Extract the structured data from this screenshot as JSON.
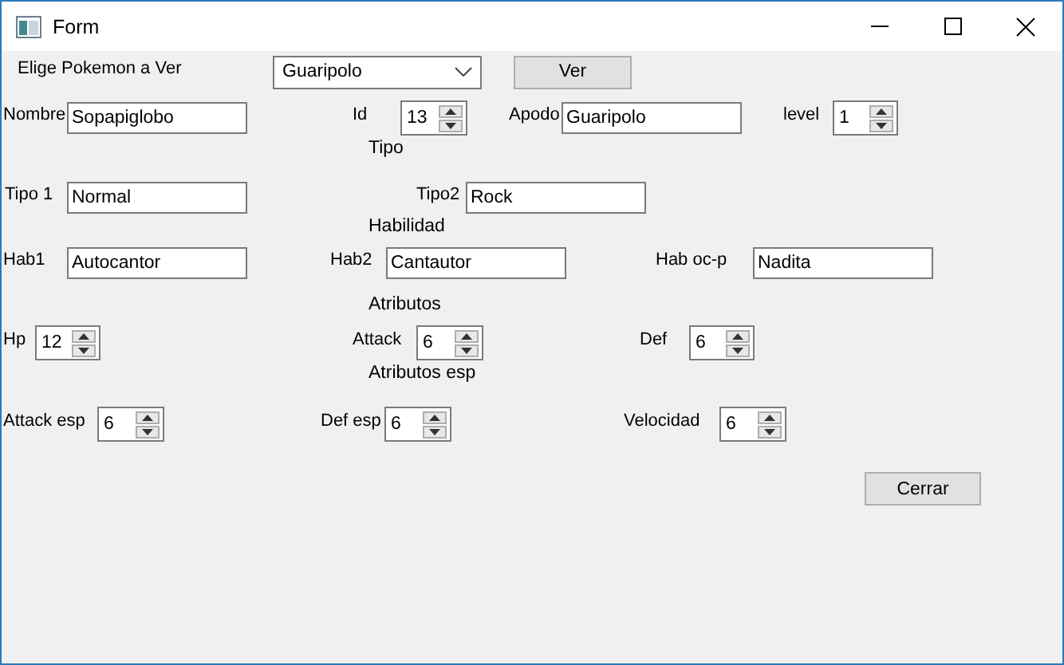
{
  "window": {
    "title": "Form"
  },
  "rows": [
    {
      "items": [
        {
          "kind": "label",
          "text": "Elige Pokemon a Ver"
        },
        {
          "kind": "combo",
          "value": "Guaripolo"
        },
        {
          "kind": "button",
          "text": "Ver"
        }
      ]
    },
    {
      "items": [
        {
          "kind": "label",
          "text": "Nombre"
        },
        {
          "kind": "text",
          "value": "Sopapiglobo"
        },
        {
          "kind": "label",
          "text": "Id"
        },
        {
          "kind": "spin",
          "value": "13"
        },
        {
          "kind": "label",
          "text": "Apodo"
        },
        {
          "kind": "text",
          "value": "Guaripolo"
        },
        {
          "kind": "label",
          "text": "level"
        },
        {
          "kind": "spin",
          "value": "1"
        }
      ]
    },
    {
      "section": "Tipo",
      "items": [
        {
          "kind": "label",
          "text": "Tipo 1"
        },
        {
          "kind": "text",
          "value": "Normal"
        },
        {
          "kind": "label",
          "text": "Tipo2"
        },
        {
          "kind": "text",
          "value": "Rock"
        }
      ]
    },
    {
      "section": "Habilidad",
      "items": [
        {
          "kind": "label",
          "text": "Hab1"
        },
        {
          "kind": "text",
          "value": "Autocantor"
        },
        {
          "kind": "label",
          "text": "Hab2"
        },
        {
          "kind": "text",
          "value": "Cantautor"
        },
        {
          "kind": "label",
          "text": "Hab  oc-p"
        },
        {
          "kind": "text",
          "value": "Nadita"
        }
      ]
    },
    {
      "section": "Atributos",
      "items": [
        {
          "kind": "label",
          "text": "Hp"
        },
        {
          "kind": "spin",
          "value": "12"
        },
        {
          "kind": "label",
          "text": "Attack"
        },
        {
          "kind": "spin",
          "value": "6"
        },
        {
          "kind": "label",
          "text": "Def"
        },
        {
          "kind": "spin",
          "value": "6"
        }
      ]
    },
    {
      "section": "Atributos esp",
      "items": [
        {
          "kind": "label",
          "text": "Attack esp"
        },
        {
          "kind": "spin",
          "value": "6"
        },
        {
          "kind": "label",
          "text": "Def esp"
        },
        {
          "kind": "spin",
          "value": "6"
        },
        {
          "kind": "label",
          "text": "Velocidad"
        },
        {
          "kind": "spin",
          "value": "6"
        }
      ]
    }
  ],
  "close_button": "Cerrar"
}
